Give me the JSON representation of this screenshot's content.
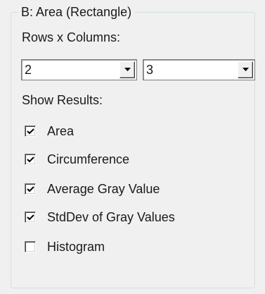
{
  "group": {
    "title": "B: Area (Rectangle)",
    "rows_columns_label": "Rows x Columns:",
    "rows_value": "2",
    "columns_value": "3",
    "show_results_label": "Show Results:",
    "options": [
      {
        "label": "Area",
        "checked": true
      },
      {
        "label": "Circumference",
        "checked": true
      },
      {
        "label": "Average Gray Value",
        "checked": true
      },
      {
        "label": "StdDev of Gray Values",
        "checked": true
      },
      {
        "label": "Histogram",
        "checked": false
      }
    ]
  }
}
